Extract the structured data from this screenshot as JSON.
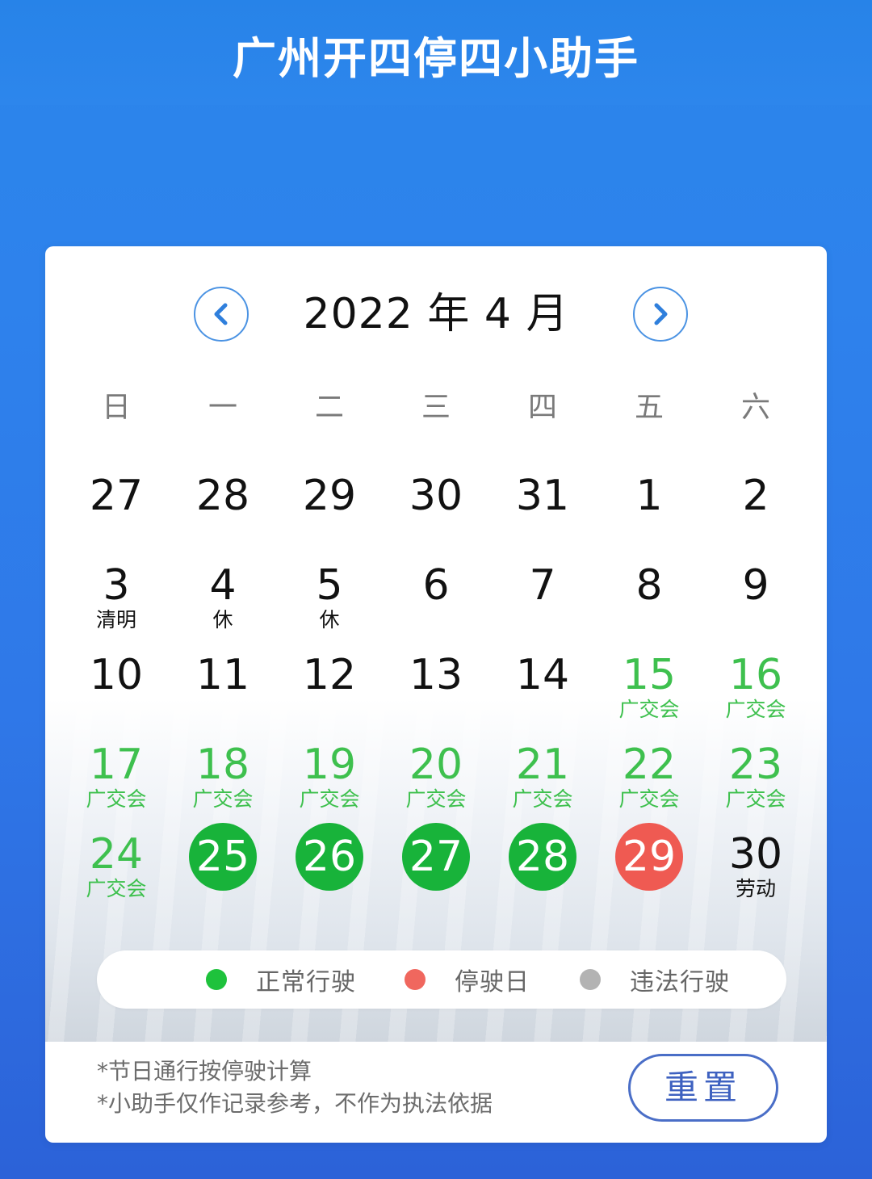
{
  "header": {
    "title": "广州开四停四小助手"
  },
  "calendar": {
    "month_title": "2022 年 4 月",
    "weekdays": [
      "日",
      "一",
      "二",
      "三",
      "四",
      "五",
      "六"
    ],
    "weeks": [
      [
        {
          "day": "27",
          "note": "",
          "style": "plain"
        },
        {
          "day": "28",
          "note": "",
          "style": "plain"
        },
        {
          "day": "29",
          "note": "",
          "style": "plain"
        },
        {
          "day": "30",
          "note": "",
          "style": "plain"
        },
        {
          "day": "31",
          "note": "",
          "style": "plain"
        },
        {
          "day": "1",
          "note": "",
          "style": "plain"
        },
        {
          "day": "2",
          "note": "",
          "style": "plain"
        }
      ],
      [
        {
          "day": "3",
          "note": "清明",
          "style": "plain"
        },
        {
          "day": "4",
          "note": "休",
          "style": "plain"
        },
        {
          "day": "5",
          "note": "休",
          "style": "plain"
        },
        {
          "day": "6",
          "note": "",
          "style": "plain"
        },
        {
          "day": "7",
          "note": "",
          "style": "plain"
        },
        {
          "day": "8",
          "note": "",
          "style": "plain"
        },
        {
          "day": "9",
          "note": "",
          "style": "plain"
        }
      ],
      [
        {
          "day": "10",
          "note": "",
          "style": "plain"
        },
        {
          "day": "11",
          "note": "",
          "style": "plain"
        },
        {
          "day": "12",
          "note": "",
          "style": "plain"
        },
        {
          "day": "13",
          "note": "",
          "style": "plain"
        },
        {
          "day": "14",
          "note": "",
          "style": "plain"
        },
        {
          "day": "15",
          "note": "广交会",
          "style": "green"
        },
        {
          "day": "16",
          "note": "广交会",
          "style": "green"
        }
      ],
      [
        {
          "day": "17",
          "note": "广交会",
          "style": "green"
        },
        {
          "day": "18",
          "note": "广交会",
          "style": "green"
        },
        {
          "day": "19",
          "note": "广交会",
          "style": "green"
        },
        {
          "day": "20",
          "note": "广交会",
          "style": "green"
        },
        {
          "day": "21",
          "note": "广交会",
          "style": "green"
        },
        {
          "day": "22",
          "note": "广交会",
          "style": "green"
        },
        {
          "day": "23",
          "note": "广交会",
          "style": "green"
        }
      ],
      [
        {
          "day": "24",
          "note": "广交会",
          "style": "green"
        },
        {
          "day": "25",
          "note": "",
          "style": "normal"
        },
        {
          "day": "26",
          "note": "",
          "style": "normal"
        },
        {
          "day": "27",
          "note": "",
          "style": "normal"
        },
        {
          "day": "28",
          "note": "",
          "style": "normal"
        },
        {
          "day": "29",
          "note": "",
          "style": "stop"
        },
        {
          "day": "30",
          "note": "劳动",
          "style": "plain"
        }
      ]
    ]
  },
  "legend": {
    "items": [
      {
        "label": "正常行驶",
        "color": "#1ec23c"
      },
      {
        "label": "停驶日",
        "color": "#f0675e"
      },
      {
        "label": "违法行驶",
        "color": "#b3b3b3"
      }
    ]
  },
  "notes": [
    "*节日通行按停驶计算",
    "*小助手仅作记录参考，不作为执法依据"
  ],
  "reset_label": "重置",
  "colors": {
    "accent_blue": "#2e82ec",
    "holiday_green": "#3ec04e",
    "normal_green": "#18b33a",
    "stop_red": "#ef5a52"
  },
  "icons": {
    "prev": "chevron-left-icon",
    "next": "chevron-right-icon"
  }
}
